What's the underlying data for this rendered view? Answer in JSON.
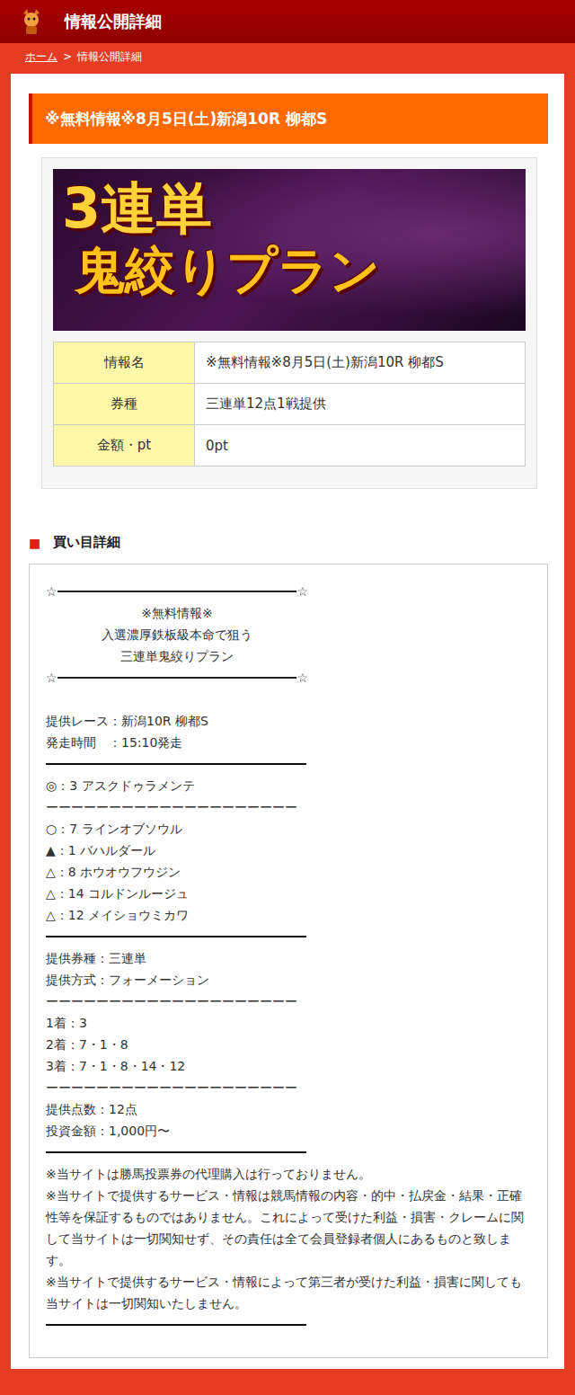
{
  "header": {
    "title": "情報公開詳細"
  },
  "breadcrumb": {
    "home": "ホーム",
    "separator": ">",
    "current": "情報公開詳細"
  },
  "title": "※無料情報※8月5日(土)新潟10R 柳都S",
  "banner": {
    "line1": "3連単",
    "line2": "鬼絞りプラン"
  },
  "info_table": [
    {
      "label": "情報名",
      "value": "※無料情報※8月5日(土)新潟10R 柳都S"
    },
    {
      "label": "券種",
      "value": "三連単12点1戦提供"
    },
    {
      "label": "金額・pt",
      "value": "0pt"
    }
  ],
  "section": {
    "icon": "■",
    "title": "買い目詳細"
  },
  "detail_lines": [
    {
      "kind": "star-rule",
      "left": "☆",
      "right": "☆"
    },
    {
      "kind": "center",
      "text": "※無料情報※"
    },
    {
      "kind": "center",
      "text": "入選濃厚鉄板級本命で狙う"
    },
    {
      "kind": "center",
      "text": "三連単鬼絞りプラン"
    },
    {
      "kind": "star-rule",
      "left": "☆",
      "right": "☆"
    },
    {
      "kind": "blank"
    },
    {
      "kind": "text",
      "text": "提供レース：新潟10R 柳都S"
    },
    {
      "kind": "text",
      "text": "発走時間　：15:10発走"
    },
    {
      "kind": "rule"
    },
    {
      "kind": "text",
      "text": "◎：3 アスクドゥラメンテ"
    },
    {
      "kind": "text",
      "text": "ーーーーーーーーーーーーーーーーーーーー"
    },
    {
      "kind": "text",
      "text": "○：7 ラインオブソウル"
    },
    {
      "kind": "text",
      "text": "▲：1 バハルダール"
    },
    {
      "kind": "text",
      "text": "△：8 ホウオウフウジン"
    },
    {
      "kind": "text",
      "text": "△：14 コルドンルージュ"
    },
    {
      "kind": "text",
      "text": "△：12 メイショウミカワ"
    },
    {
      "kind": "rule"
    },
    {
      "kind": "text",
      "text": "提供券種：三連単"
    },
    {
      "kind": "text",
      "text": "提供方式：フォーメーション"
    },
    {
      "kind": "text",
      "text": "ーーーーーーーーーーーーーーーーーーーー"
    },
    {
      "kind": "text",
      "text": "1着：3"
    },
    {
      "kind": "text",
      "text": "2着：7・1・8"
    },
    {
      "kind": "text",
      "text": "3着：7・1・8・14・12"
    },
    {
      "kind": "text",
      "text": "ーーーーーーーーーーーーーーーーーーーー"
    },
    {
      "kind": "text",
      "text": "提供点数：12点"
    },
    {
      "kind": "text",
      "text": "投資金額：1,000円〜"
    },
    {
      "kind": "rule"
    },
    {
      "kind": "text",
      "text": "※当サイトは勝馬投票券の代理購入は行っておりません。"
    },
    {
      "kind": "text",
      "text": "※当サイトで提供するサービス・情報は競馬情報の内容・的中・払戻金・結果・正確性等を保証するものではありません。これによって受けた利益・損害・クレームに関して当サイトは一切関知せず、その責任は全て会員登録者個人にあるものと致します。"
    },
    {
      "kind": "text",
      "text": "※当サイトで提供するサービス・情報によって第三者が受けた利益・損害に関しても当サイトは一切関知いたしません。"
    },
    {
      "kind": "rule"
    }
  ]
}
